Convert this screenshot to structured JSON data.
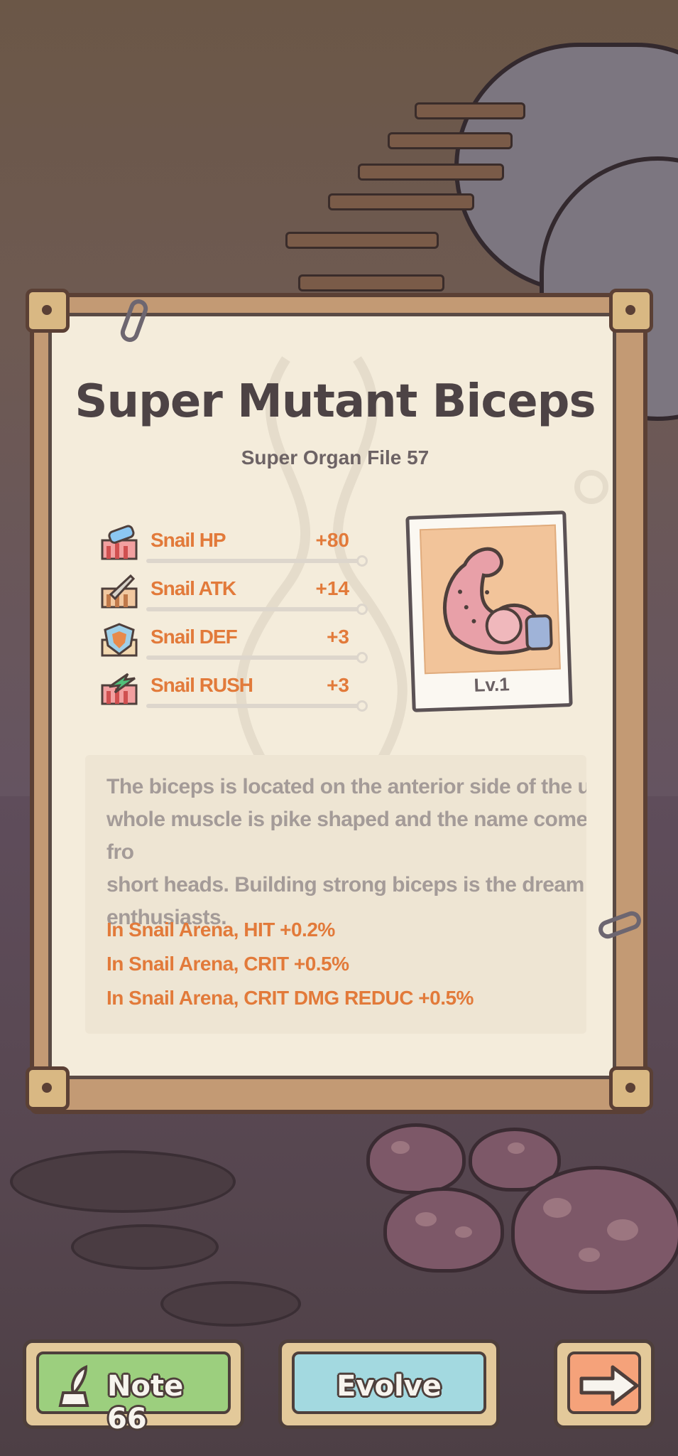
{
  "card": {
    "title": "Super Mutant Biceps",
    "subtitle": "Super Organ File 57"
  },
  "stats": [
    {
      "label": "Snail HP",
      "value": "+80",
      "icon": "hp-icon",
      "color": "#6fb0e8"
    },
    {
      "label": "Snail ATK",
      "value": "+14",
      "icon": "sword-icon",
      "color": "#c9c2b6"
    },
    {
      "label": "Snail DEF",
      "value": "+3",
      "icon": "shield-icon",
      "color": "#e88a4a"
    },
    {
      "label": "Snail RUSH",
      "value": "+3",
      "icon": "rush-icon",
      "color": "#4fc07a"
    }
  ],
  "photo": {
    "level": "Lv.1",
    "icon": "flexed-arm-icon"
  },
  "description": {
    "text": "The biceps is located on the anterior side of the uppe\nwhole muscle is pike shaped and the name comes fro\nshort heads. Building strong biceps is the dream of n\nenthusiasts.",
    "bonuses": [
      "In Snail Arena, HIT +0.2%",
      "In Snail Arena, CRIT +0.5%",
      "In Snail Arena, CRIT DMG REDUC +0.5%"
    ]
  },
  "buttons": {
    "note_label": "Note 66",
    "note_icon": "quill-ink-icon",
    "evolve_label": "Evolve",
    "next_icon": "right-arrow-icon"
  },
  "colors": {
    "stat_text": "#e27a3a",
    "title": "#4d4345",
    "paper": "#f4ecdb",
    "note_button": "#9ccf7e",
    "evolve_button": "#a3d9e0",
    "next_button": "#f5a27a"
  }
}
